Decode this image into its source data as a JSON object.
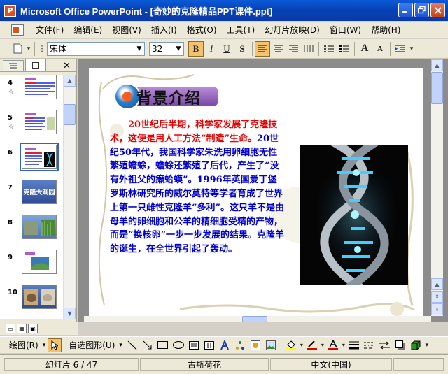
{
  "window": {
    "title": "Microsoft Office PowerPoint - [奇妙的克隆精品PPT课件.ppt]",
    "app_icon": "P",
    "buttons": [
      "minimize-icon",
      "restore-icon",
      "close-icon"
    ]
  },
  "menubar": {
    "items": [
      "文件(F)",
      "编辑(E)",
      "视图(V)",
      "插入(I)",
      "格式(O)",
      "工具(T)",
      "幻灯片放映(D)",
      "窗口(W)",
      "帮助(H)"
    ]
  },
  "toolbar": {
    "font_name": "宋体",
    "font_size": "32",
    "bold": "B",
    "italic": "I",
    "underline": "U",
    "shadow": "S",
    "grow_font": "A",
    "shrink_font": "A"
  },
  "outline": {
    "slides": [
      {
        "num": "4",
        "star": "☆"
      },
      {
        "num": "5",
        "star": "☆"
      },
      {
        "num": "6",
        "star": ""
      },
      {
        "num": "7",
        "star": "",
        "thumb_text": "克隆大观园"
      },
      {
        "num": "8",
        "star": ""
      },
      {
        "num": "9",
        "star": ""
      },
      {
        "num": "10",
        "star": ""
      }
    ],
    "selected_index": 2
  },
  "slide": {
    "title": "背景介绍",
    "body_red": "20世纪后半期，科学家发展了克隆技术，这便是用人工方法“制造”生命。",
    "body_blue": "20世纪50年代，我国科学家朱洗用卵细胞无性繁殖蟾蜍，蟾蜍还繁殖了后代，产生了“没有外祖父的癞蛤蟆”。1996年英国爱丁堡罗斯林研究所的威尔莫特等学者育成了世界上第一只雌性克隆羊“多利”。这只羊不是由母羊的卵细胞和公羊的精细胞受精的产物，而是“换核卵”一步一步发展的结果。克隆羊的诞生，在全世界引起了轰动。",
    "colors": {
      "red": "#e60000",
      "blue": "#0000cc"
    }
  },
  "drawbar": {
    "draw_label": "绘图(R)",
    "autoshape_label": "自选图形(U)"
  },
  "statusbar": {
    "slide_info": "幻灯片 6 / 47",
    "design": "古瓶荷花",
    "language": "中文(中国)"
  }
}
